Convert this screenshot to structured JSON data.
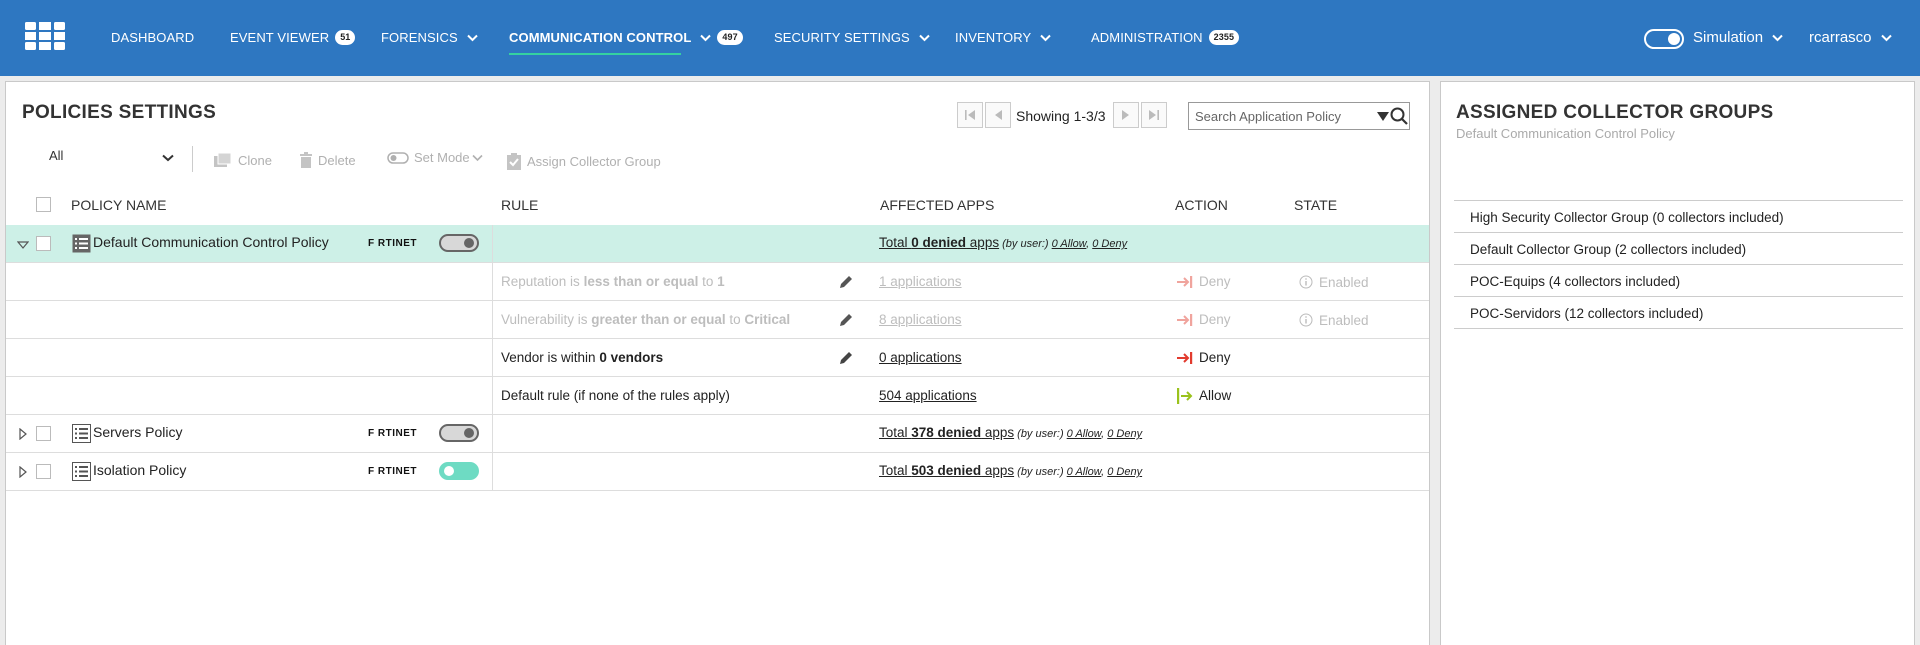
{
  "nav": {
    "items": [
      {
        "label": "DASHBOARD"
      },
      {
        "label": "EVENT VIEWER",
        "badge": "51"
      },
      {
        "label": "FORENSICS"
      },
      {
        "label": "COMMUNICATION CONTROL",
        "badge": "497"
      },
      {
        "label": "SECURITY SETTINGS"
      },
      {
        "label": "INVENTORY"
      },
      {
        "label": "ADMINISTRATION",
        "badge": "2355"
      }
    ],
    "active_item": "COMMUNICATION CONTROL",
    "simulation_label": "Simulation",
    "user": "rcarrasco"
  },
  "policies": {
    "title": "POLICIES SETTINGS",
    "showing": "Showing 1-3/3",
    "search_placeholder": "Search Application Policy",
    "filter_value": "All",
    "toolbar": {
      "clone": "Clone",
      "delete": "Delete",
      "set_mode": "Set Mode",
      "assign": "Assign Collector Group"
    },
    "columns": {
      "policy_name": "POLICY NAME",
      "rule": "RULE",
      "affected_apps": "AFFECTED APPS",
      "action": "ACTION",
      "state": "STATE"
    },
    "vendor_logo_text": "F RTINET",
    "default_policy": {
      "name": "Default Communication Control Policy",
      "apps_prefix": "Total ",
      "apps_count": "0 denied",
      "apps_suffix": " apps",
      "by_user": " (by user:) ",
      "allow": "0 Allow",
      "comma": ", ",
      "deny": "0 Deny",
      "toggle_on": false
    },
    "rules": [
      {
        "pre": "Reputation is ",
        "bold": "less than or equal",
        "mid": " to ",
        "bold2": "1",
        "apps": "1 applications",
        "action": "Deny",
        "state": "Enabled",
        "muted": true
      },
      {
        "pre": "Vulnerability is ",
        "bold": "greater than or equal",
        "mid": " to ",
        "bold2": "Critical",
        "apps": "8 applications",
        "action": "Deny",
        "state": "Enabled",
        "muted": true
      },
      {
        "pre": "Vendor is within ",
        "bold": "0 vendors",
        "mid": "",
        "bold2": "",
        "apps": "0 applications",
        "action": "Deny",
        "state": "",
        "muted": false
      },
      {
        "pre": "Default rule (if none of the rules apply)",
        "bold": "",
        "mid": "",
        "bold2": "",
        "apps": "504 applications",
        "action": "Allow",
        "state": "",
        "muted": false
      }
    ],
    "servers_policy": {
      "name": "Servers Policy",
      "apps_prefix": "Total ",
      "apps_count": "378 denied",
      "apps_suffix": " apps",
      "by_user": " (by user:) ",
      "allow": "0 Allow",
      "comma": ", ",
      "deny": "0 Deny",
      "toggle_on": false
    },
    "isolation_policy": {
      "name": "Isolation Policy",
      "apps_prefix": "Total ",
      "apps_count": "503 denied",
      "apps_suffix": " apps",
      "by_user": " (by user:) ",
      "allow": "0 Allow",
      "comma": ", ",
      "deny": "0 Deny",
      "toggle_on": true
    }
  },
  "assigned": {
    "title": "ASSIGNED COLLECTOR GROUPS",
    "subtitle": "Default Communication Control Policy",
    "groups": [
      "High Security Collector Group (0 collectors included)",
      "Default Collector Group (2 collectors included)",
      "POC-Equips (4 collectors included)",
      "POC-Servidors (12 collectors included)"
    ]
  },
  "colors": {
    "nav_bg": "#2e77c1",
    "active_underline": "#35d1a0",
    "selected_row": "#cdf0e7",
    "deny": "#e23b2e",
    "allow": "#9ac21c",
    "toggle_on": "#6edbc3"
  }
}
